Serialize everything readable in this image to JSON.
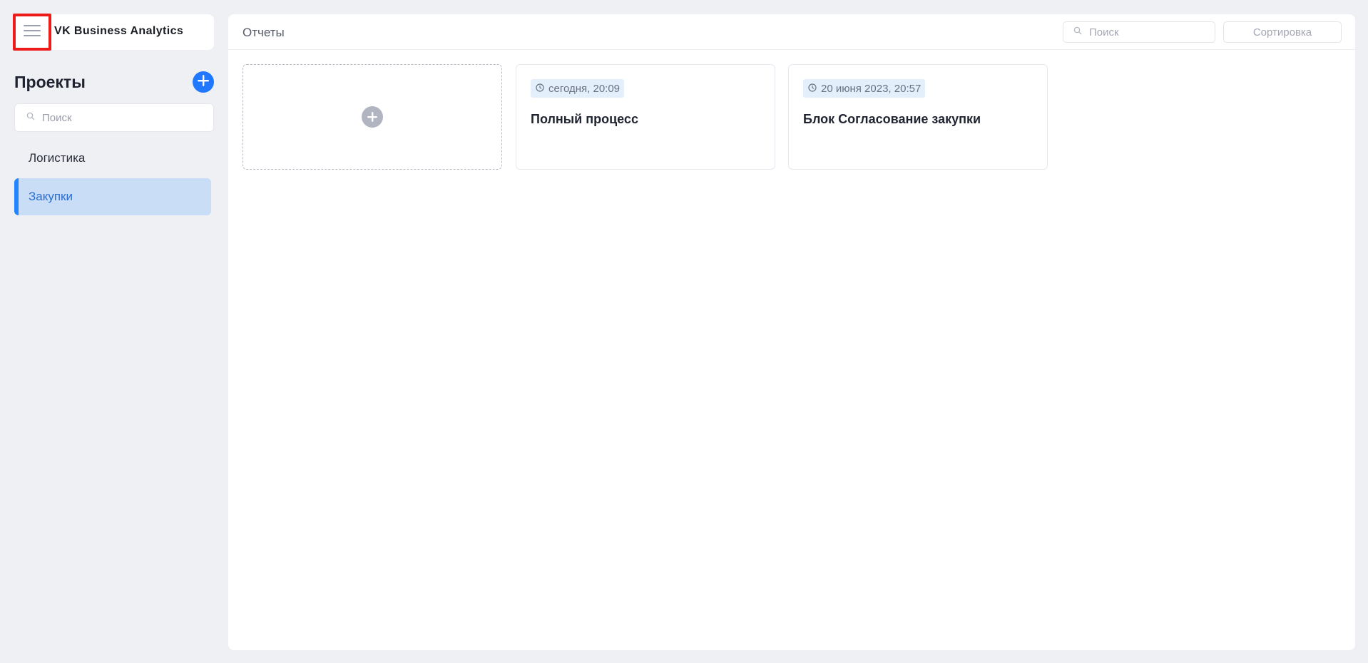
{
  "app": {
    "brand": "VK Business Analytics"
  },
  "sidebar": {
    "title": "Проекты",
    "search_placeholder": "Поиск",
    "projects": [
      {
        "label": "Логистика",
        "active": false
      },
      {
        "label": "Закупки",
        "active": true
      }
    ]
  },
  "main": {
    "title": "Отчеты",
    "search_placeholder": "Поиск",
    "sort_label": "Сортировка",
    "reports": [
      {
        "date": "сегодня, 20:09",
        "title": "Полный процесс"
      },
      {
        "date": "20 июня 2023, 20:57",
        "title": "Блок Согласование закупки"
      }
    ]
  },
  "colors": {
    "accent": "#1f78ff",
    "active_item_bg": "#c9ddf7",
    "highlight_border": "#ee1b1b",
    "badge_bg": "#e3f0fb"
  },
  "icons": {
    "menu": "menu-lines-icon",
    "add": "plus-circle-icon",
    "search": "search-icon",
    "clock": "clock-icon"
  }
}
